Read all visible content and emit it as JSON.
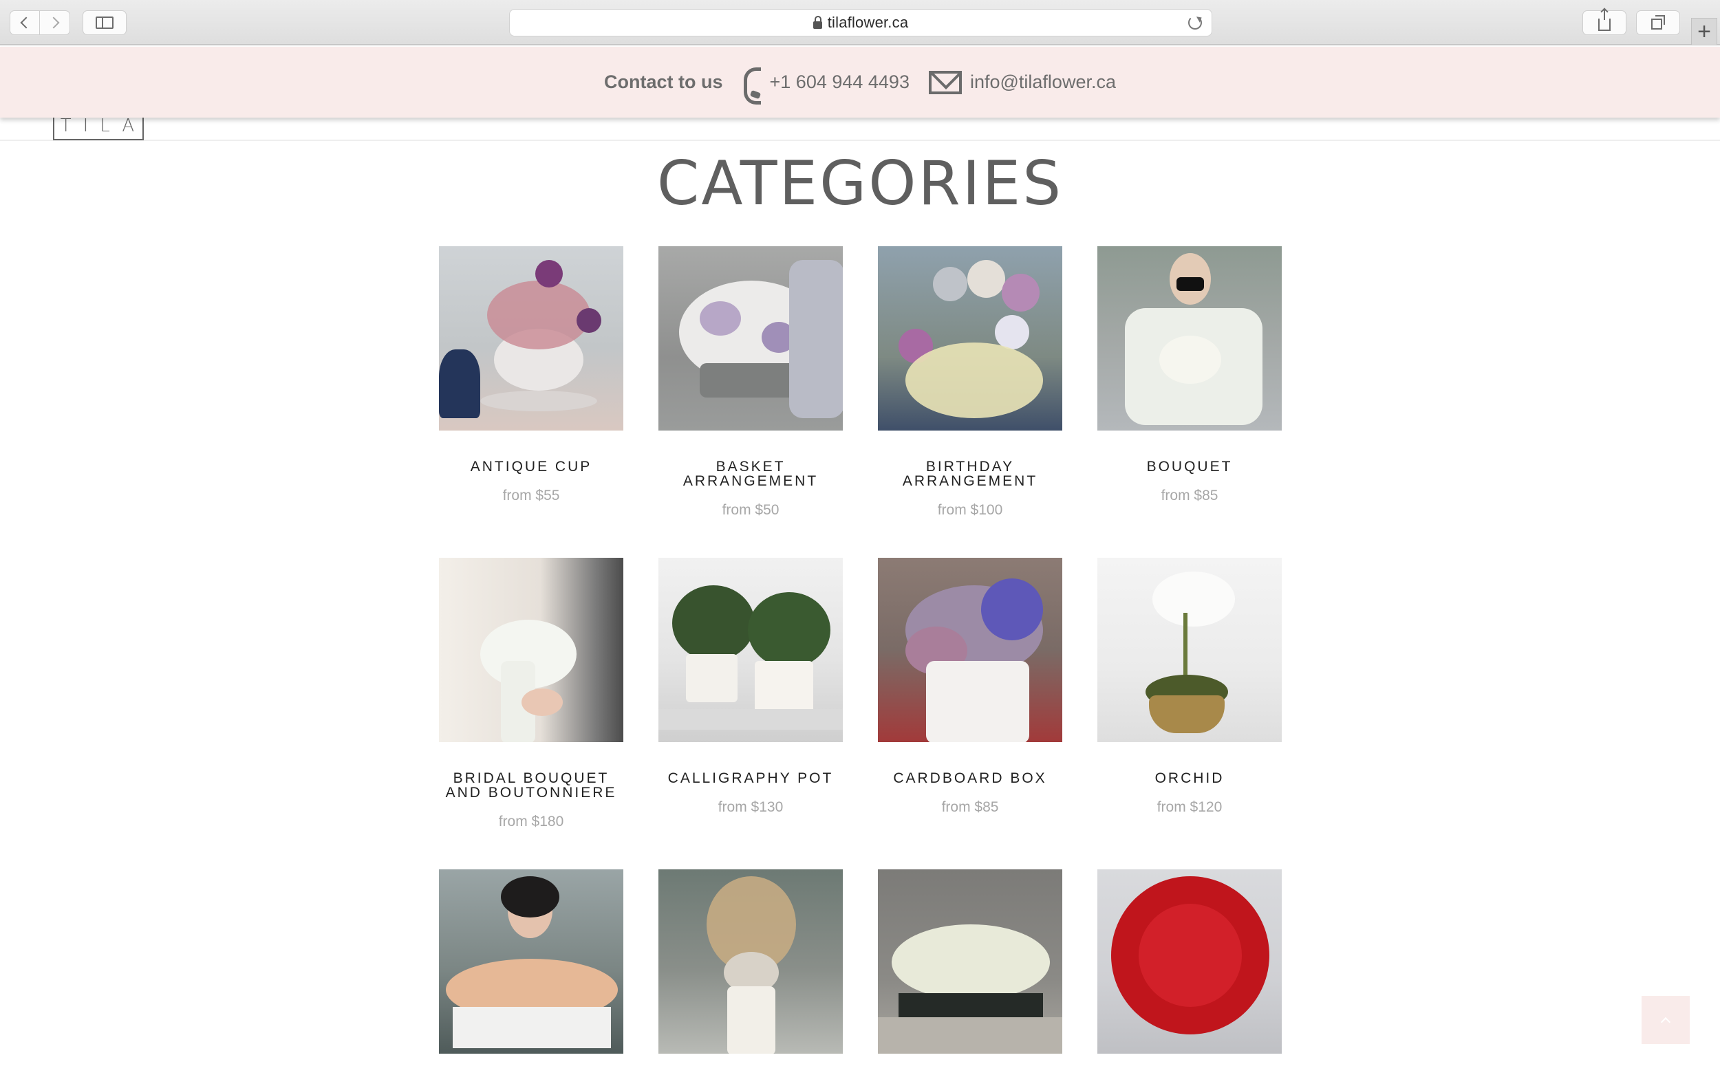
{
  "browser": {
    "url": "tilaflower.ca"
  },
  "contact": {
    "label": "Contact to us",
    "phone": "+1 604 944 4493",
    "email": "info@tilaflower.ca"
  },
  "logo": {
    "text": "TILA"
  },
  "page": {
    "title": "CATEGORIES"
  },
  "categories": [
    {
      "name": "ANTIQUE CUP",
      "price": "from $55"
    },
    {
      "name": "BASKET ARRANGEMENT",
      "price": "from $50"
    },
    {
      "name": "BIRTHDAY ARRANGEMENT",
      "price": "from $100"
    },
    {
      "name": "BOUQUET",
      "price": "from $85"
    },
    {
      "name": "BRIDAL BOUQUET AND BOUTONNIERE",
      "price": "from $180"
    },
    {
      "name": "CALLIGRAPHY POT",
      "price": "from $130"
    },
    {
      "name": "CARDBOARD BOX",
      "price": "from $85"
    },
    {
      "name": "ORCHID",
      "price": "from $120"
    },
    {
      "name": "",
      "price": ""
    },
    {
      "name": "",
      "price": ""
    },
    {
      "name": "",
      "price": ""
    },
    {
      "name": "",
      "price": ""
    }
  ]
}
